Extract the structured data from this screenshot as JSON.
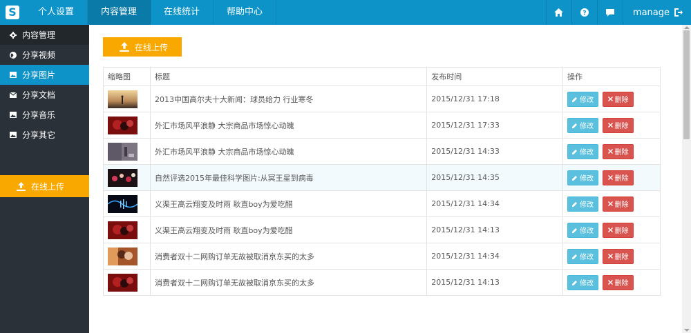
{
  "logo": "S",
  "topnav": [
    {
      "label": "个人设置",
      "active": false
    },
    {
      "label": "内容管理",
      "active": true
    },
    {
      "label": "在线统计",
      "active": false
    },
    {
      "label": "帮助中心",
      "active": false
    }
  ],
  "topright": {
    "icons": [
      "home-icon",
      "help-icon",
      "comment-icon"
    ],
    "user": "manage",
    "logout_icon": "logout-icon"
  },
  "sidebar": {
    "items": [
      {
        "label": "内容管理",
        "icon": "gear-icon"
      },
      {
        "label": "分享视频",
        "icon": "globe-icon"
      },
      {
        "label": "分享图片",
        "icon": "picture-icon"
      },
      {
        "label": "分享文档",
        "icon": "envelope-icon"
      },
      {
        "label": "分享音乐",
        "icon": "picture-icon"
      },
      {
        "label": "分享其它",
        "icon": "picture-icon"
      }
    ],
    "upload_label": "在线上传"
  },
  "main": {
    "upload_label": "在线上传",
    "columns": [
      "缩略图",
      "标题",
      "发布时间",
      "操作"
    ],
    "rows": [
      {
        "title": "2013中国高尔夫十大新闻：球员给力 行业寒冬",
        "time": "2015/12/31 17:18",
        "thumb": "sunset"
      },
      {
        "title": "外汇市场风平浪静 大宗商品市场惊心动魄",
        "time": "2015/12/31 17:33",
        "thumb": "red"
      },
      {
        "title": "外汇市场风平浪静 大宗商品市场惊心动魄",
        "time": "2015/12/31 14:33",
        "thumb": "gray"
      },
      {
        "title": "自然评选2015年最佳科学图片:从冥王星到病毒",
        "time": "2015/12/31 14:35",
        "thumb": "stage"
      },
      {
        "title": "义渠王高云翔变及时雨 耿直boy为爱吃醋",
        "time": "2015/12/31 14:34",
        "thumb": "blue"
      },
      {
        "title": "义渠王高云翔变及时雨 耿直boy为爱吃醋",
        "time": "2015/12/31 14:13",
        "thumb": "red"
      },
      {
        "title": "消费者双十二网购订单无故被取消京东买的太多",
        "time": "2015/12/31 14:34",
        "thumb": "couple"
      },
      {
        "title": "消费者双十二网购订单无故被取消京东买的太多",
        "time": "2015/12/31 14:13",
        "thumb": "red"
      }
    ],
    "edit_label": "修改",
    "delete_label": "删除"
  },
  "colors": {
    "topbar": "#0e93c8",
    "sidebar": "#2b3138",
    "accent_orange": "#f9a800",
    "edit": "#5bc0de",
    "delete": "#d9534f"
  }
}
